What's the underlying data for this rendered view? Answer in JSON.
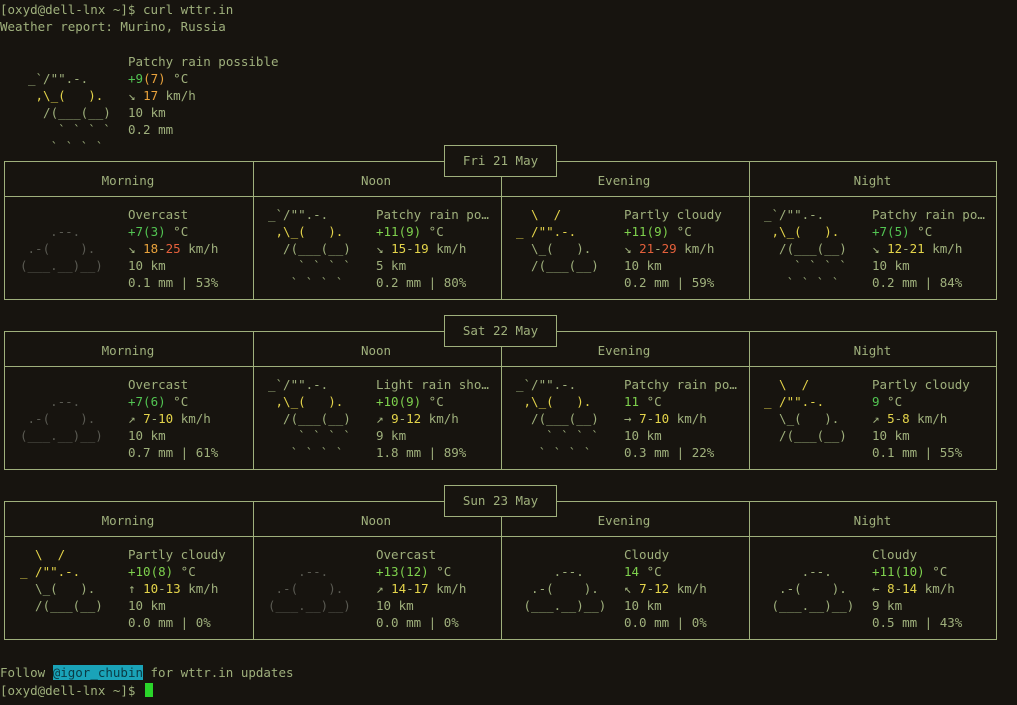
{
  "terminal": {
    "prompt1": "[oxyd@dell-lnx ~]$ curl wttr.in",
    "report_title": "Weather report: Murino, Russia",
    "footer_prefix": "Follow ",
    "footer_handle": "@igor_chubin",
    "footer_suffix": " for wttr.in updates",
    "prompt2": "[oxyd@dell-lnx ~]$ "
  },
  "current": {
    "condition": "Patchy rain possible",
    "temp_main": "+9",
    "temp_feels": "(7)",
    "temp_unit": " °C",
    "wind_arrow": "↘ ",
    "wind": "17",
    "wind_unit": " km/h",
    "visibility": "10 km",
    "precip": "0.2 mm"
  },
  "columns": [
    "Morning",
    "Noon",
    "Evening",
    "Night"
  ],
  "days": [
    {
      "date": "Fri 21 May",
      "periods": [
        {
          "condition": "Overcast",
          "temp": "+7(3)",
          "unit": " °C",
          "arrow": "↘ ",
          "wind_a": "18",
          "dash": "-",
          "wind_b": "25",
          "wind_unit": " km/h",
          "visibility": "10 km",
          "precip": "0.1 mm | 53%"
        },
        {
          "condition": "Patchy rain po…",
          "temp": "+11(9)",
          "unit": " °C",
          "arrow": "↘ ",
          "wind_a": "15",
          "dash": "-",
          "wind_b": "19",
          "wind_unit": " km/h",
          "visibility": "5 km",
          "precip": "0.2 mm | 80%"
        },
        {
          "condition": "Partly cloudy",
          "temp": "+11(9)",
          "unit": " °C",
          "arrow": "↘ ",
          "wind_a": "21",
          "dash": "-",
          "wind_b": "29",
          "wind_unit": " km/h",
          "visibility": "10 km",
          "precip": "0.2 mm | 59%"
        },
        {
          "condition": "Patchy rain po…",
          "temp": "+7(5)",
          "unit": " °C",
          "arrow": "↘ ",
          "wind_a": "12",
          "dash": "-",
          "wind_b": "21",
          "wind_unit": " km/h",
          "visibility": "10 km",
          "precip": "0.2 mm | 84%"
        }
      ]
    },
    {
      "date": "Sat 22 May",
      "periods": [
        {
          "condition": "Overcast",
          "temp": "+7(6)",
          "unit": " °C",
          "arrow": "↗ ",
          "wind_a": "7",
          "dash": "-",
          "wind_b": "10",
          "wind_unit": " km/h",
          "visibility": "10 km",
          "precip": "0.7 mm | 61%"
        },
        {
          "condition": "Light rain sho…",
          "temp": "+10(9)",
          "unit": " °C",
          "arrow": "↗ ",
          "wind_a": "9",
          "dash": "-",
          "wind_b": "12",
          "wind_unit": " km/h",
          "visibility": "9 km",
          "precip": "1.8 mm | 89%"
        },
        {
          "condition": "Patchy rain po…",
          "temp": "11",
          "unit": " °C",
          "arrow": "→ ",
          "wind_a": "7",
          "dash": "-",
          "wind_b": "10",
          "wind_unit": " km/h",
          "visibility": "10 km",
          "precip": "0.3 mm | 22%"
        },
        {
          "condition": "Partly cloudy",
          "temp": "9",
          "unit": " °C",
          "arrow": "↗ ",
          "wind_a": "5",
          "dash": "-",
          "wind_b": "8",
          "wind_unit": " km/h",
          "visibility": "10 km",
          "precip": "0.1 mm | 55%"
        }
      ]
    },
    {
      "date": "Sun 23 May",
      "periods": [
        {
          "condition": "Partly cloudy",
          "temp": "+10(8)",
          "unit": " °C",
          "arrow": "↑ ",
          "wind_a": "10",
          "dash": "-",
          "wind_b": "13",
          "wind_unit": " km/h",
          "visibility": "10 km",
          "precip": "0.0 mm | 0%"
        },
        {
          "condition": "Overcast",
          "temp": "+13(12)",
          "unit": " °C",
          "arrow": "↗ ",
          "wind_a": "14",
          "dash": "-",
          "wind_b": "17",
          "wind_unit": " km/h",
          "visibility": "10 km",
          "precip": "0.0 mm | 0%"
        },
        {
          "condition": "Cloudy",
          "temp": "14",
          "unit": " °C",
          "arrow": "↖ ",
          "wind_a": "7",
          "dash": "-",
          "wind_b": "12",
          "wind_unit": " km/h",
          "visibility": "10 km",
          "precip": "0.0 mm | 0%"
        },
        {
          "condition": "Cloudy",
          "temp": "+11(10)",
          "unit": " °C",
          "arrow": "← ",
          "wind_a": "8",
          "dash": "-",
          "wind_b": "14",
          "wind_unit": " km/h",
          "visibility": "9 km",
          "precip": "0.5 mm | 43%"
        }
      ]
    }
  ],
  "art": {
    "rain_cloud": [
      "_`/\"\".-.   ",
      " ,\\_(   ).  ",
      "  /(___(__) ",
      "    ` ` ` ` ",
      "   ` ` ` `  "
    ],
    "overcast": [
      "    .--.    ",
      " .-(    ).  ",
      "(___.__)__) "
    ],
    "partly_cloudy": [
      "  \\  /      ",
      "_ /\"\".-.    ",
      "  \\_(   ).  ",
      "  /(___(__) "
    ],
    "cloudy": [
      "     .--.    ",
      "  .-(    ).  ",
      " (___.__)__) "
    ]
  },
  "colors": {
    "background": "#17140f",
    "foreground": "#9fb07c",
    "temp_green": "#52c452",
    "wind_yellow": "#e4d44a",
    "wind_orange": "#e8a23c",
    "wind_red": "#e4603b",
    "handle_bg": "#1aa3b8",
    "cursor": "#2ad52a"
  }
}
